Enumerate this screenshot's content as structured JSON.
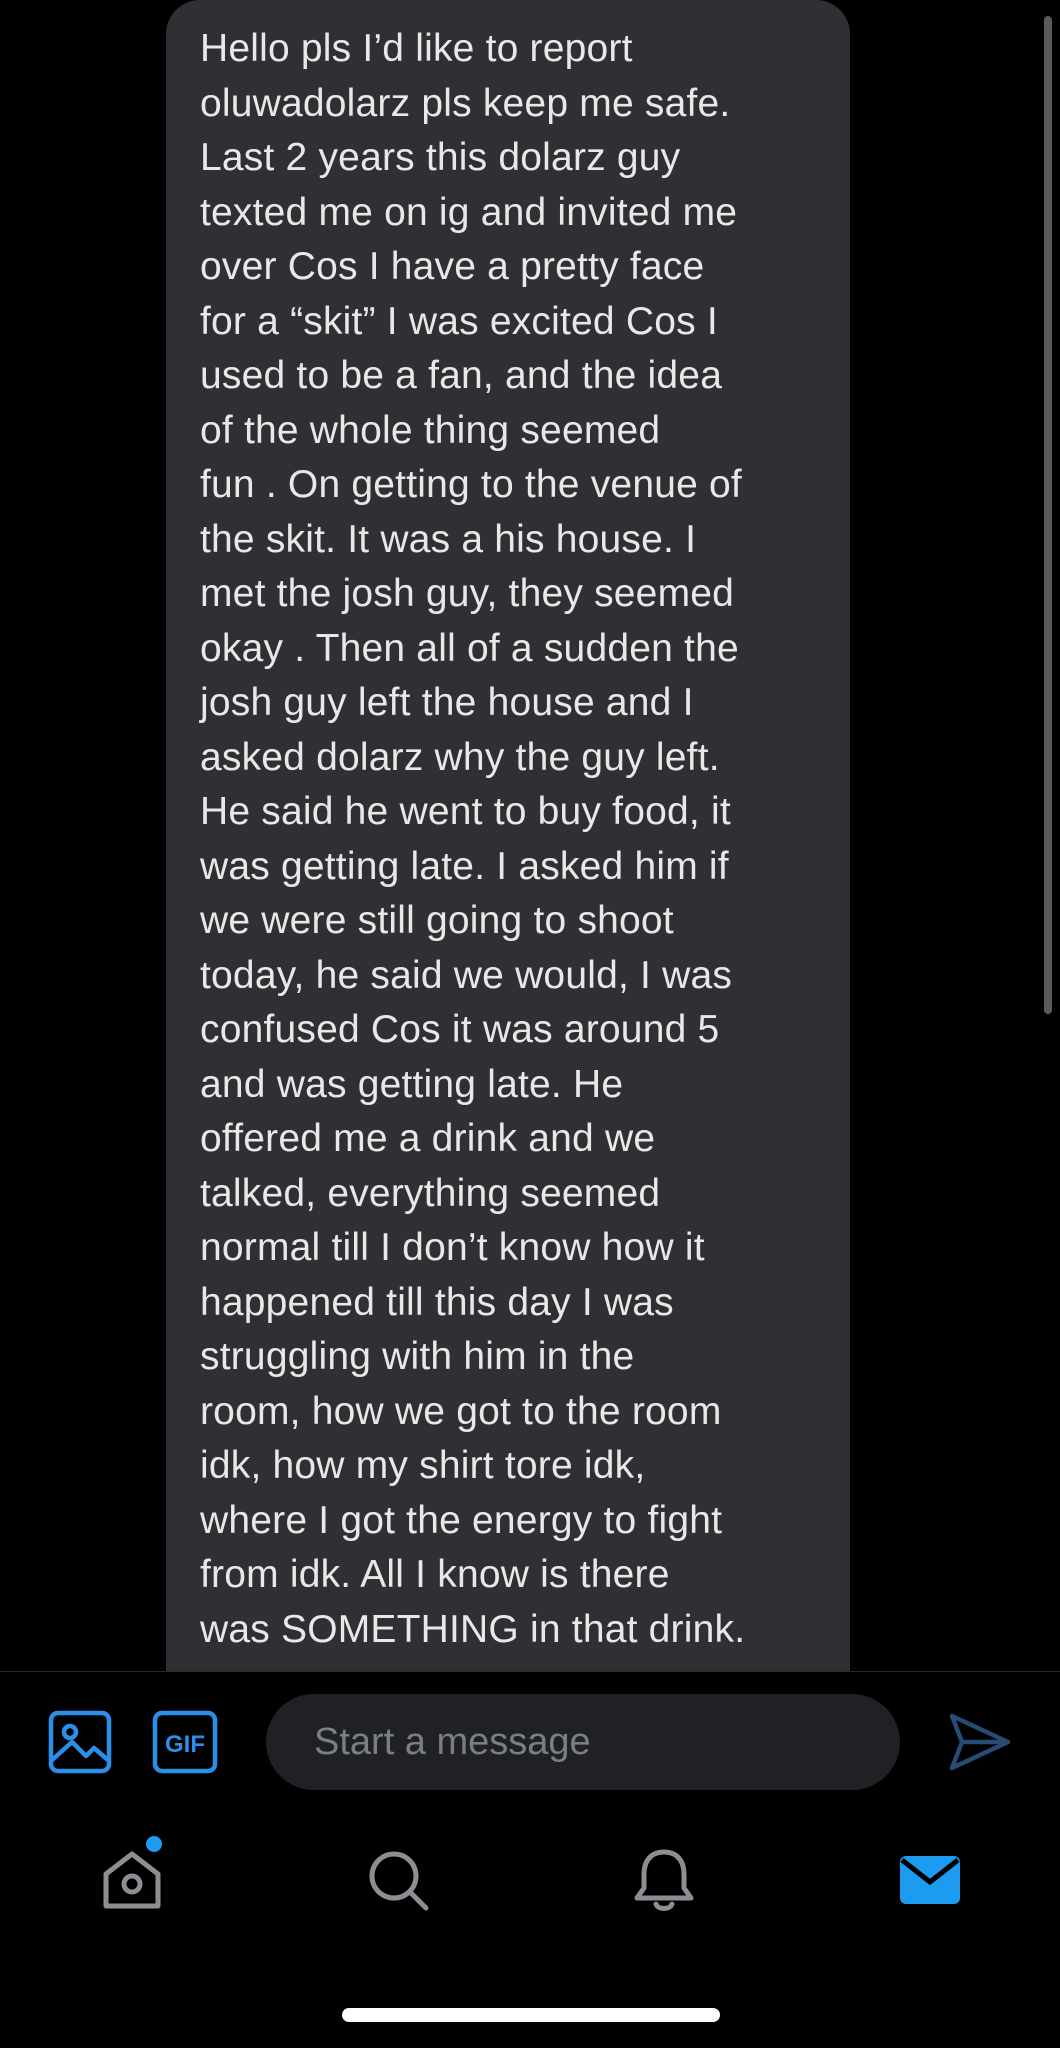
{
  "message": {
    "lines": [
      "Hello pls I’d like to report",
      "oluwadolarz pls keep me safe.",
      "Last 2 years this dolarz guy",
      "texted me on ig and invited me",
      "over Cos I have a pretty face",
      "for a “skit” I was excited Cos I",
      "used to be a fan, and the idea",
      "of the whole thing seemed",
      "fun . On getting to the venue of",
      "the skit. It was a his house. I",
      "met the josh guy, they seemed",
      "okay . Then all of a sudden the",
      "josh guy left the house and I",
      "asked dolarz why the guy left.",
      "He said he went to buy food, it",
      "was getting late. I asked him if",
      "we were still going to shoot",
      "today, he said we would, I was",
      "confused Cos it was around 5",
      "and was getting late. He",
      "offered me a drink and we",
      "talked, everything seemed",
      "normal till I don’t know how it",
      "happened till this day I was",
      "struggling with him in the",
      "room, how we got to the room",
      "idk, how my shirt tore idk,",
      "where I got the energy to fight",
      "from idk. All I know is there",
      "was SOMETHING in that drink."
    ]
  },
  "composer": {
    "media_icon": "image-icon",
    "gif_icon": "gif-icon",
    "gif_label": "GIF",
    "placeholder": "Start a message",
    "value": "",
    "send_icon": "send-icon"
  },
  "tabbar": {
    "items": [
      {
        "name": "home",
        "icon": "home-icon",
        "has_badge": true
      },
      {
        "name": "search",
        "icon": "search-icon"
      },
      {
        "name": "notifications",
        "icon": "bell-icon"
      },
      {
        "name": "messages",
        "icon": "mail-icon",
        "active": true
      }
    ]
  },
  "colors": {
    "background": "#000000",
    "bubble": "#2f3033",
    "bubble_text": "#e8e8e8",
    "accent": "#1d9bf0",
    "icon_accent": "#2b8ee8",
    "send_dim": "#274b75",
    "tab_icon": "#8b8f94",
    "input_bg": "#202124",
    "placeholder": "#7b7f84"
  }
}
